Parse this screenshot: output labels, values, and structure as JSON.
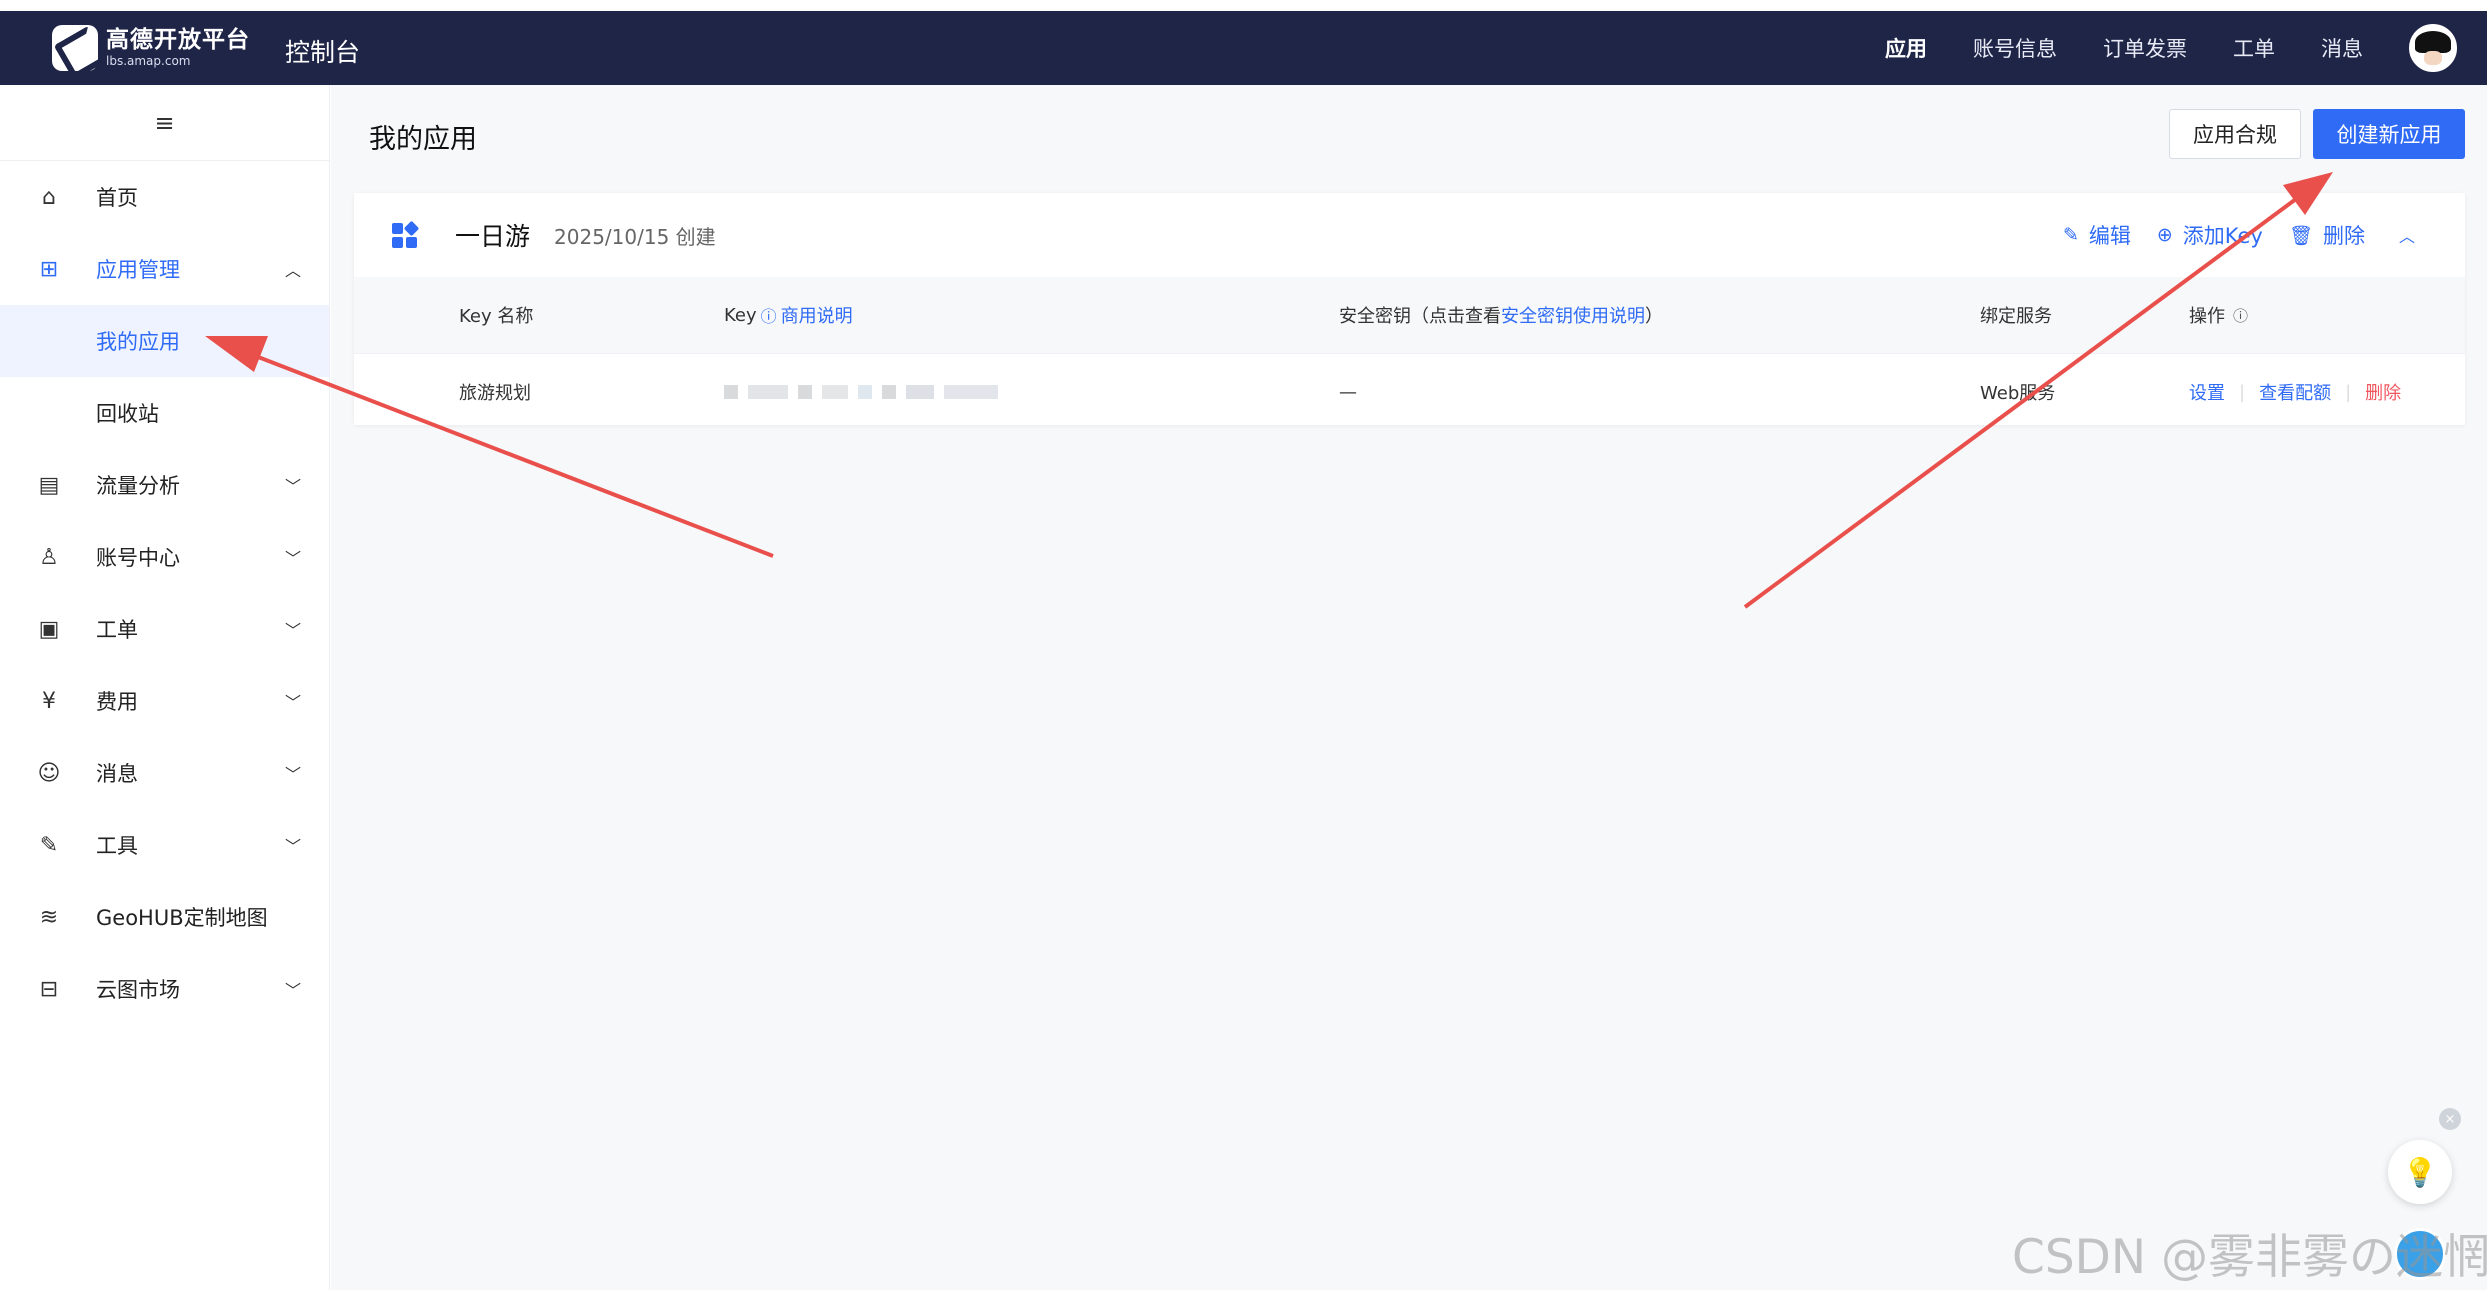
{
  "header": {
    "logo_title": "高德开放平台",
    "logo_sub": "lbs.amap.com",
    "console": "控制台",
    "nav": [
      "应用",
      "账号信息",
      "订单发票",
      "工单",
      "消息"
    ],
    "active_nav": "应用"
  },
  "sidebar": {
    "menu_icon": "≡",
    "items": [
      {
        "label": "首页",
        "icon": "home-icon"
      },
      {
        "label": "应用管理",
        "icon": "grid-icon"
      },
      {
        "label": "我的应用"
      },
      {
        "label": "回收站"
      },
      {
        "label": "流量分析",
        "icon": "chart-icon"
      },
      {
        "label": "账号中心",
        "icon": "user-icon"
      },
      {
        "label": "工单",
        "icon": "ticket-icon"
      },
      {
        "label": "费用",
        "icon": "money-icon"
      },
      {
        "label": "消息",
        "icon": "message-icon"
      },
      {
        "label": "工具",
        "icon": "wrench-icon"
      },
      {
        "label": "GeoHUB定制地图",
        "icon": "layers-icon"
      },
      {
        "label": "云图市场",
        "icon": "store-icon"
      }
    ]
  },
  "main": {
    "title": "我的应用",
    "compliance_button": "应用合规",
    "create_button": "创建新应用",
    "app": {
      "name": "一日游",
      "created": "2025/10/15 创建",
      "edit": "编辑",
      "add_key": "添加Key",
      "delete": "删除"
    },
    "table": {
      "headers": {
        "key_name": "Key 名称",
        "key": "Key",
        "key_help": "商用说明",
        "secret_prefix": "安全密钥（点击查看",
        "secret_link": "安全密钥使用说明",
        "secret_suffix": "）",
        "service": "绑定服务",
        "ops": "操作"
      },
      "rows": [
        {
          "key_name": "旅游规划",
          "secret": "—",
          "service": "Web服务",
          "op_settings": "设置",
          "op_quota": "查看配额",
          "op_delete": "删除"
        }
      ]
    }
  },
  "watermark": "CSDN @雾非雾の迷惘",
  "colors": {
    "topbar": "#1f2547",
    "accent": "#2f6bf5",
    "danger": "#f0565e",
    "arrow": "#e9504c"
  }
}
